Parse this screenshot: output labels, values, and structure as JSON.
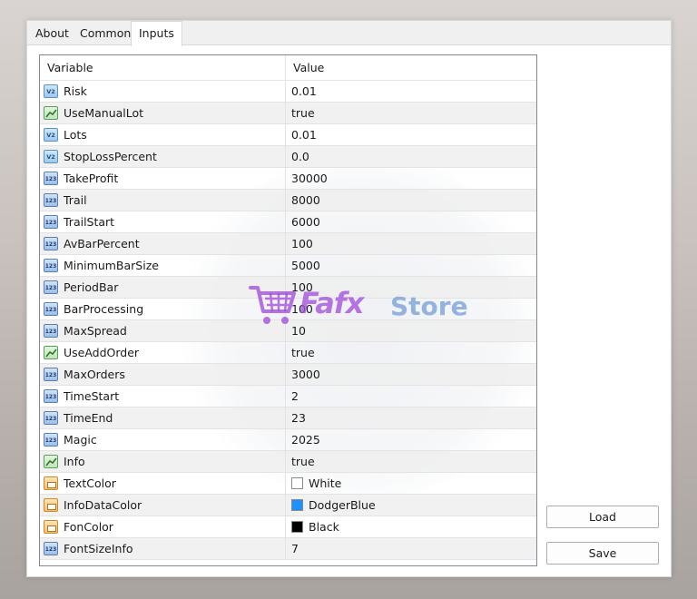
{
  "tabs": [
    {
      "label": "About"
    },
    {
      "label": "Common"
    },
    {
      "label": "Inputs"
    }
  ],
  "columns": {
    "variable": "Variable",
    "value": "Value"
  },
  "rows": [
    {
      "name": "Risk",
      "type": "double",
      "value": "0.01"
    },
    {
      "name": "UseManualLot",
      "type": "bool",
      "value": "true"
    },
    {
      "name": "Lots",
      "type": "double",
      "value": "0.01"
    },
    {
      "name": "StopLossPercent",
      "type": "double",
      "value": "0.0"
    },
    {
      "name": "TakeProfit",
      "type": "int",
      "value": "30000"
    },
    {
      "name": "Trail",
      "type": "int",
      "value": "8000"
    },
    {
      "name": "TrailStart",
      "type": "int",
      "value": "6000"
    },
    {
      "name": "AvBarPercent",
      "type": "int",
      "value": "100"
    },
    {
      "name": "MinimumBarSize",
      "type": "int",
      "value": "5000"
    },
    {
      "name": "PeriodBar",
      "type": "int",
      "value": "100"
    },
    {
      "name": "BarProcessing",
      "type": "int",
      "value": "100"
    },
    {
      "name": "MaxSpread",
      "type": "int",
      "value": "10"
    },
    {
      "name": "UseAddOrder",
      "type": "bool",
      "value": "true"
    },
    {
      "name": "MaxOrders",
      "type": "int",
      "value": "3000"
    },
    {
      "name": "TimeStart",
      "type": "int",
      "value": "2"
    },
    {
      "name": "TimeEnd",
      "type": "int",
      "value": "23"
    },
    {
      "name": "Magic",
      "type": "int",
      "value": "2025"
    },
    {
      "name": "Info",
      "type": "bool",
      "value": "true"
    },
    {
      "name": "TextColor",
      "type": "color",
      "value": "White",
      "swatch": "#ffffff"
    },
    {
      "name": "InfoDataColor",
      "type": "color",
      "value": "DodgerBlue",
      "swatch": "#1e90ff"
    },
    {
      "name": "FonColor",
      "type": "color",
      "value": "Black",
      "swatch": "#000000"
    },
    {
      "name": "FontSizeInfo",
      "type": "int",
      "value": "7"
    }
  ],
  "icon_text": {
    "double": "V2",
    "int": "123"
  },
  "buttons": {
    "load": "Load",
    "save": "Save"
  },
  "watermark": {
    "brand": "Fafx",
    "store": "Store"
  }
}
